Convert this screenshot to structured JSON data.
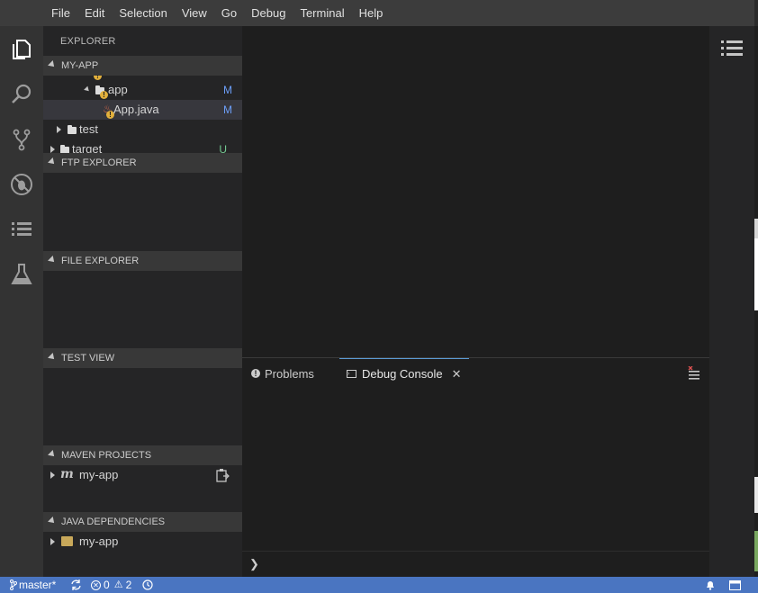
{
  "menu": [
    "File",
    "Edit",
    "Selection",
    "View",
    "Go",
    "Debug",
    "Terminal",
    "Help"
  ],
  "activity_bar": [
    "files-icon",
    "search-icon",
    "source-control-icon",
    "debug-icon",
    "list-icon",
    "test-flask-icon"
  ],
  "sidebar": {
    "title": "EXPLORER",
    "project_section": "MY-APP",
    "tree": [
      {
        "label": "app",
        "status": "M"
      },
      {
        "label": "App.java",
        "status": "M"
      },
      {
        "label": "test",
        "status": ""
      },
      {
        "label": "target",
        "status": "U"
      }
    ],
    "sections": [
      "FTP EXPLORER",
      "FILE EXPLORER",
      "TEST VIEW",
      "MAVEN PROJECTS",
      "JAVA DEPENDENCIES"
    ],
    "maven_item": "my-app",
    "java_dep_item": "my-app"
  },
  "panel": {
    "tabs": [
      "Problems",
      "Debug Console"
    ],
    "prompt": "❯"
  },
  "statusbar": {
    "branch": "master*",
    "errors": "0",
    "warnings": "2"
  },
  "colors": {
    "accent": "#4a75c1",
    "git_modified": "#6c9ef8",
    "git_untracked": "#73c991",
    "warning": "#e2b03c"
  }
}
